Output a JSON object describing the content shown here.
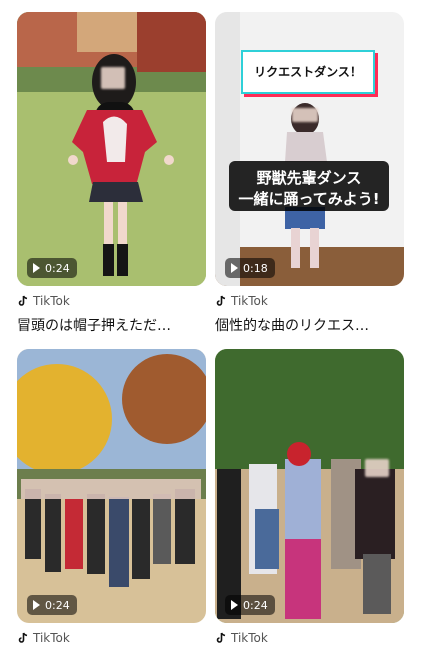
{
  "cards": [
    {
      "duration": "0:24",
      "source": "TikTok",
      "caption": "冒頭のは帽子押えただ…"
    },
    {
      "duration": "0:18",
      "source": "TikTok",
      "caption": "個性的な曲のリクエス…",
      "overlay_top": "リクエストダンス！",
      "overlay_line1": "野獣先輩ダンス",
      "overlay_line2": "一緒に踊ってみよう!"
    },
    {
      "duration": "0:24",
      "source": "TikTok",
      "caption": ""
    },
    {
      "duration": "0:24",
      "source": "TikTok",
      "caption": ""
    }
  ],
  "icons": {
    "play": "play-icon",
    "brand": "tiktok-icon"
  }
}
